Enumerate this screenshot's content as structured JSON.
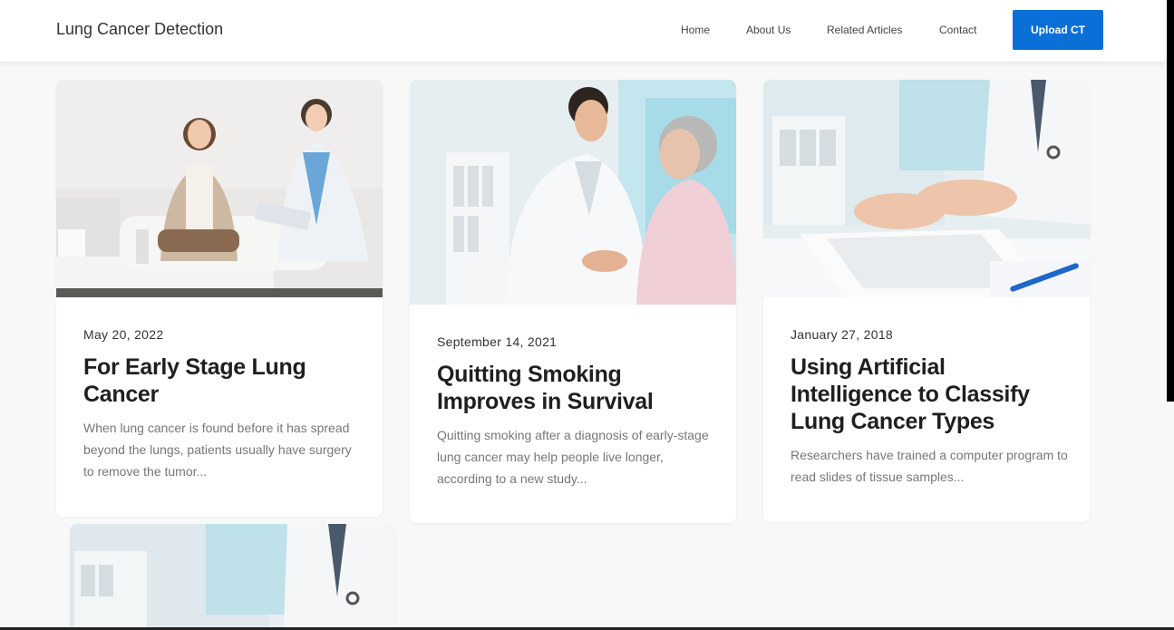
{
  "navbar": {
    "brand": "Lung Cancer Detection",
    "links": [
      "Home",
      "About Us",
      "Related Articles",
      "Contact"
    ],
    "cta_label": "Upload CT",
    "cta_color": "#0a6fd6"
  },
  "articles": [
    {
      "date": "May 20, 2022",
      "title": "For Early Stage Lung Cancer",
      "excerpt": "When lung cancer is found before it has spread beyond the lungs, patients usually have surgery to remove the tumor..."
    },
    {
      "date": "September 14, 2021",
      "title": "Quitting Smoking Improves in Survival",
      "excerpt": "Quitting smoking after a diagnosis of early-stage lung cancer may help people live longer, according to a new study..."
    },
    {
      "date": "January 27, 2018",
      "title": "Using Artificial Intelligence to Classify Lung Cancer Types",
      "excerpt": "Researchers have trained a computer program to read slides of tissue samples..."
    }
  ],
  "colors": {
    "page_bg": "#f8f8f8",
    "card_bg": "#ffffff",
    "title": "#1f1f1f",
    "excerpt": "#777777"
  }
}
